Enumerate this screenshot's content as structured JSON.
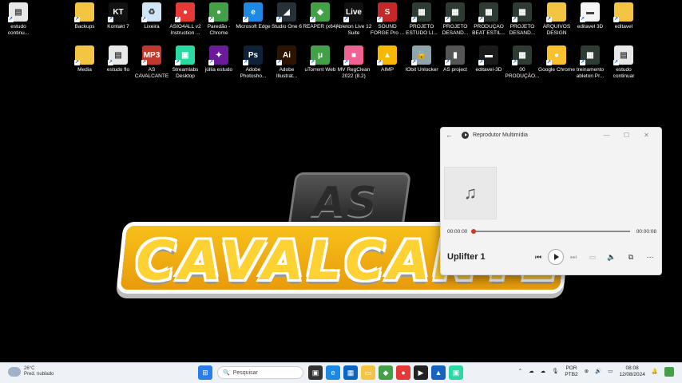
{
  "desktop": {
    "row1": [
      {
        "label": "estudo continu...",
        "icon": "document-icon",
        "color": "#e8e8e8",
        "glyph": "▤"
      },
      {
        "label": "Backups",
        "icon": "folder-icon",
        "color": "#f4c542",
        "glyph": ""
      },
      {
        "label": "Kontakt 7",
        "icon": "kontakt-icon",
        "color": "#111111",
        "glyph": "KT"
      },
      {
        "label": "Lixeira",
        "icon": "recycle-bin-icon",
        "color": "#cfe6f7",
        "glyph": "♻"
      },
      {
        "label": "ASIO4ALL v2 Instruction ...",
        "icon": "chrome-icon",
        "color": "#e53935",
        "glyph": "●"
      },
      {
        "label": "Paredão - Chrome",
        "icon": "chrome-icon",
        "color": "#43a047",
        "glyph": "●"
      },
      {
        "label": "Microsoft Edge",
        "icon": "edge-icon",
        "color": "#1e88e5",
        "glyph": "e"
      },
      {
        "label": "Studio One 6",
        "icon": "studio-one-icon",
        "color": "#263238",
        "glyph": "◢"
      },
      {
        "label": "REAPER (x64)",
        "icon": "reaper-icon",
        "color": "#43a047",
        "glyph": "◆"
      },
      {
        "label": "Ableton Live 12 Suite",
        "icon": "ableton-icon",
        "color": "#111111",
        "glyph": "Live"
      },
      {
        "label": "SOUND FORGE Pro ...",
        "icon": "sound-forge-icon",
        "color": "#c62828",
        "glyph": "S"
      },
      {
        "label": "PROJETO ESTUDO LI...",
        "icon": "ableton-project-icon",
        "color": "#2e3b32",
        "glyph": "▦"
      },
      {
        "label": "PROJETO DESAND...",
        "icon": "ableton-project-icon",
        "color": "#2e3b32",
        "glyph": "▦"
      },
      {
        "label": "PRODUÇÃO BEAT ESTIL...",
        "icon": "ableton-project-icon",
        "color": "#2e3b32",
        "glyph": "▦"
      },
      {
        "label": "PROJETO DESAND...",
        "icon": "ableton-project-icon",
        "color": "#2e3b32",
        "glyph": "▦"
      },
      {
        "label": "ARQUIVOS DESIGN",
        "icon": "folder-icon",
        "color": "#f4c542",
        "glyph": ""
      },
      {
        "label": "editavel 3D",
        "icon": "image-file-icon",
        "color": "#f5f5f5",
        "glyph": "▬"
      },
      {
        "label": "editavel",
        "icon": "image-file-icon",
        "color": "#f4c542",
        "glyph": ""
      }
    ],
    "row2": [
      {
        "label": "Media",
        "icon": "folder-icon",
        "color": "#f4c542",
        "glyph": ""
      },
      {
        "label": "estudo flo",
        "icon": "document-icon",
        "color": "#e8e8e8",
        "glyph": "▤"
      },
      {
        "label": "AS CAVALCANTE",
        "icon": "mp3-file-icon",
        "color": "#c0392b",
        "glyph": "MP3"
      },
      {
        "label": "Streamlabs Desktop",
        "icon": "streamlabs-icon",
        "color": "#2bd9a3",
        "glyph": "▣"
      },
      {
        "label": "júllia estudo",
        "icon": "image-file-icon",
        "color": "#6a1b9a",
        "glyph": "✦"
      },
      {
        "label": "Adobe Photosho...",
        "icon": "photoshop-icon",
        "color": "#0d2238",
        "glyph": "Ps"
      },
      {
        "label": "Adobe Illustrat...",
        "icon": "illustrator-icon",
        "color": "#2d1400",
        "glyph": "Ai"
      },
      {
        "label": "uTorrent Web",
        "icon": "utorrent-icon",
        "color": "#43a047",
        "glyph": "μ"
      },
      {
        "label": "MV RegClean 2022 (8.2)",
        "icon": "regclean-icon",
        "color": "#f06292",
        "glyph": "■"
      },
      {
        "label": "AIMP",
        "icon": "aimp-icon",
        "color": "#f9b800",
        "glyph": "▲"
      },
      {
        "label": "IObit Unlocker",
        "icon": "unlocker-icon",
        "color": "#90a4ae",
        "glyph": "🔓"
      },
      {
        "label": "AS project",
        "icon": "image-file-icon",
        "color": "#555555",
        "glyph": "▮"
      },
      {
        "label": "editavel-3D",
        "icon": "image-file-icon",
        "color": "#1a1a1a",
        "glyph": "▬"
      },
      {
        "label": "00 PRODUÇÃO...",
        "icon": "ableton-project-icon",
        "color": "#2e3b32",
        "glyph": "▦"
      },
      {
        "label": "Google Chrome",
        "icon": "chrome-icon",
        "color": "#fbc02d",
        "glyph": "●"
      },
      {
        "label": "treinamento ableton Pr...",
        "icon": "ableton-project-icon",
        "color": "#2e3b32",
        "glyph": "▦"
      },
      {
        "label": "estudo continuar",
        "icon": "document-icon",
        "color": "#e8e8e8",
        "glyph": "▤"
      }
    ],
    "wallpaper": {
      "top_text": "AS",
      "main_text": "CAVALCANTE"
    }
  },
  "media_player": {
    "app_title": "Reprodutor Multimídia",
    "current_time": "00:00:00",
    "total_time": "00:00:08",
    "track_title": "Uplifter 1",
    "progress_fraction": 0,
    "accent": "#d3371c"
  },
  "taskbar": {
    "weather_temp": "26°C",
    "weather_desc": "Pred. nublado",
    "search_placeholder": "Pesquisar",
    "language": "POR",
    "keyboard": "PTB2",
    "time": "08:08",
    "date": "12/08/2024"
  }
}
